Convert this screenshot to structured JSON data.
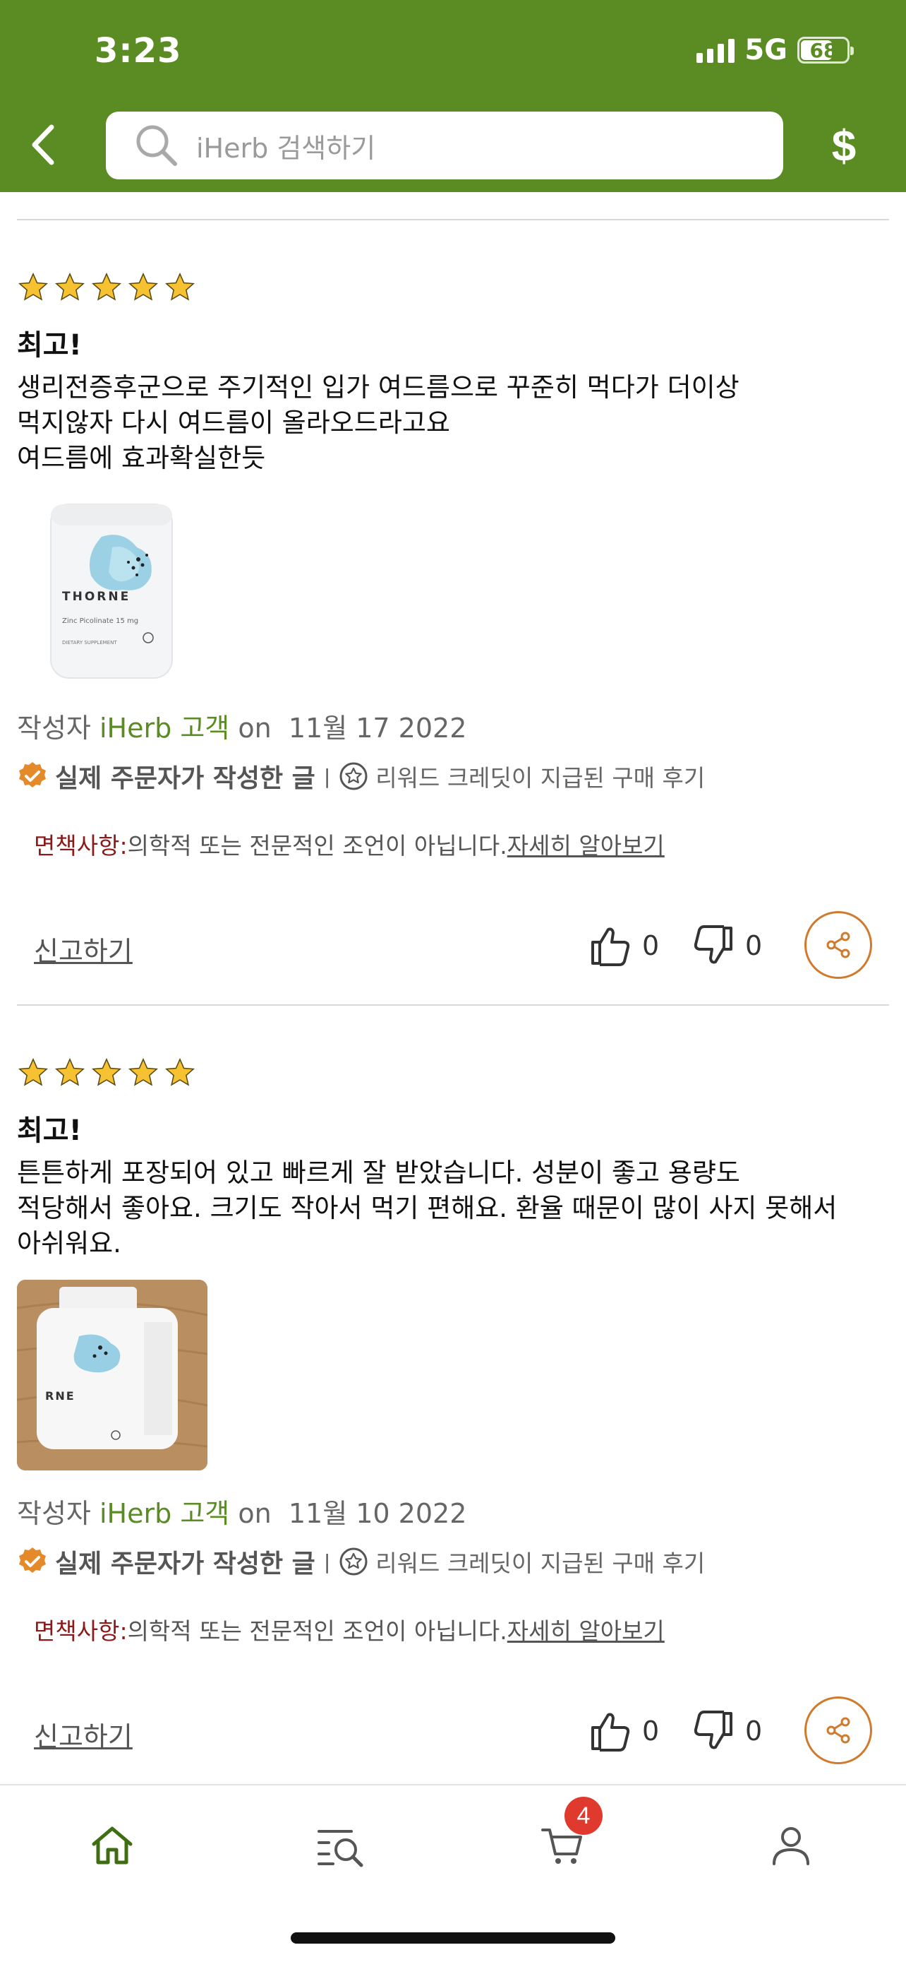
{
  "status": {
    "time": "3:23",
    "network": "5G",
    "battery": "68"
  },
  "header": {
    "search_placeholder": "iHerb 검색하기",
    "currency_icon": "$"
  },
  "reviews": [
    {
      "rating": 5,
      "title": "최고!",
      "body_lines": [
        "생리전증후군으로 주기적인 입가 여드름으로 꾸준히 먹다가 더이상",
        "먹지않자 다시 여드름이 올라오드라고요",
        "여드름에 효과확실한듯"
      ],
      "image_alt": "THORNE Zinc Picolinate 15 mg bottle",
      "image_brand": "THORNE",
      "image_product": "Zinc Picolinate 15 mg",
      "image_sub": "DIETARY SUPPLEMENT",
      "author_prefix": "작성자",
      "author": "iHerb 고객",
      "on": "on",
      "date": "11월 17 2022",
      "verified": "실제 주문자가 작성한 글",
      "reward": "리워드 크레딧이 지급된 구매 후기",
      "disclaimer_label": "면책사항:",
      "disclaimer_text": "의학적 또는 전문적인 조언이 아닙니다.",
      "disclaimer_link": "자세히 알아보기",
      "report": "신고하기",
      "likes": "0",
      "dislikes": "0"
    },
    {
      "rating": 5,
      "title": "최고!",
      "body_lines": [
        "튼튼하게 포장되어 있고 빠르게 잘 받았습니다. 성분이 좋고 용량도",
        "적당해서 좋아요. 크기도 작아서 먹기 편해요. 환율 때문이 많이 사지 못해서",
        "아쉬워요."
      ],
      "image_alt": "THORNE bottle photo on wooden table",
      "image_brand": "RNE",
      "author_prefix": "작성자",
      "author": "iHerb 고객",
      "on": "on",
      "date": "11월 10 2022",
      "verified": "실제 주문자가 작성한 글",
      "reward": "리워드 크레딧이 지급된 구매 후기",
      "disclaimer_label": "면책사항:",
      "disclaimer_text": "의학적 또는 전문적인 조언이 아닙니다.",
      "disclaimer_link": "자세히 알아보기",
      "report": "신고하기",
      "likes": "0",
      "dislikes": "0"
    }
  ],
  "bottom_nav": {
    "items": [
      "home-icon",
      "search-list-icon",
      "cart-icon",
      "account-icon"
    ],
    "cart_count": "4"
  },
  "colors": {
    "brand_green": "#5b8c24",
    "star": "#f6c232",
    "accent_orange": "#d07a2d",
    "badge_red": "#e03a2e",
    "disclaimer_red": "#8b1a1a"
  }
}
